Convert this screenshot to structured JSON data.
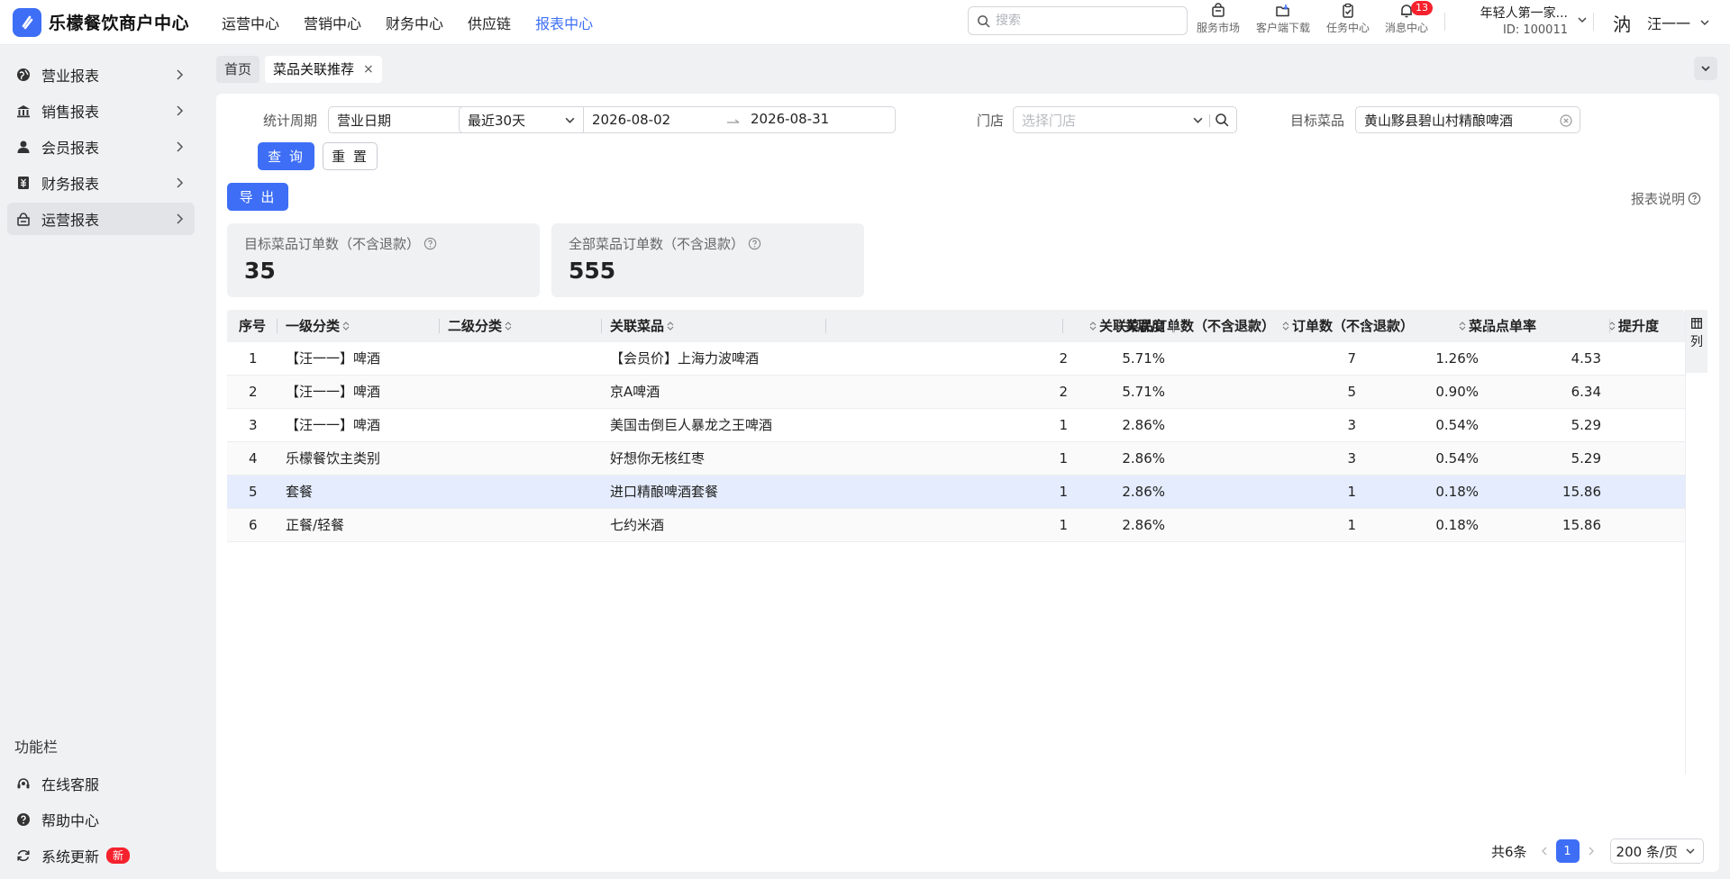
{
  "brand": {
    "name": "乐檬餐饮商户中心",
    "logo_icon": "brand-logo-icon",
    "accent": "#3d6ef5"
  },
  "topnav": [
    {
      "label": "运营中心",
      "active": false
    },
    {
      "label": "营销中心",
      "active": false
    },
    {
      "label": "财务中心",
      "active": false
    },
    {
      "label": "供应链",
      "active": false
    },
    {
      "label": "报表中心",
      "active": true
    }
  ],
  "search": {
    "placeholder": "搜索",
    "value": ""
  },
  "tools": [
    {
      "label": "服务市场",
      "icon": "shop-bag-icon"
    },
    {
      "label": "客户端下载",
      "icon": "folder-download-icon"
    },
    {
      "label": "任务中心",
      "icon": "clipboard-check-icon"
    },
    {
      "label": "消息中心",
      "icon": "bell-icon",
      "badge": "13"
    }
  ],
  "store": {
    "name": "年轻人第一家...",
    "id": "ID: 100011"
  },
  "user": {
    "avatar_text": "汭",
    "name": "汪一一"
  },
  "sidebar": {
    "items": [
      {
        "label": "营业报表",
        "icon": "globe-icon",
        "active": false
      },
      {
        "label": "销售报表",
        "icon": "bank-icon",
        "active": false
      },
      {
        "label": "会员报表",
        "icon": "person-icon",
        "active": false
      },
      {
        "label": "财务报表",
        "icon": "ledger-icon",
        "active": false
      },
      {
        "label": "运营报表",
        "icon": "operations-icon",
        "active": true
      }
    ],
    "func_title": "功能栏",
    "func_items": [
      {
        "label": "在线客服",
        "icon": "headset-icon"
      },
      {
        "label": "帮助中心",
        "icon": "question-circle-icon"
      },
      {
        "label": "系统更新",
        "icon": "refresh-icon",
        "badge": "新"
      }
    ]
  },
  "tabs": [
    {
      "label": "首页",
      "active": false
    },
    {
      "label": "菜品关联推荐",
      "active": true,
      "close": "×"
    }
  ],
  "filters": {
    "period_label": "统计周期",
    "date_type": "营业日期",
    "range_preset": "最近30天",
    "start_date": "2026-08-02",
    "end_date": "2026-08-31",
    "store_label": "门店",
    "store_placeholder": "选择门店",
    "target_label": "目标菜品",
    "target_value": "黄山黟县碧山村精酿啤酒"
  },
  "actions": {
    "query": "查 询",
    "reset": "重 置",
    "export": "导 出",
    "help": "报表说明"
  },
  "stats": [
    {
      "label": "目标菜品订单数（不含退款）",
      "value": "35"
    },
    {
      "label": "全部菜品订单数（不含退款）",
      "value": "555"
    }
  ],
  "table": {
    "columns": [
      "序号",
      "一级分类",
      "二级分类",
      "关联菜品",
      "关联菜品订单数（不含退款）",
      "关联度",
      "订单数（不含退款）",
      "菜品点单率",
      "提升度"
    ],
    "rows": [
      [
        "1",
        "【汪一一】啤酒",
        "",
        "【会员价】上海力波啤酒",
        "2",
        "5.71%",
        "7",
        "1.26%",
        "4.53"
      ],
      [
        "2",
        "【汪一一】啤酒",
        "",
        "京A啤酒",
        "2",
        "5.71%",
        "5",
        "0.90%",
        "6.34"
      ],
      [
        "3",
        "【汪一一】啤酒",
        "",
        "美国击倒巨人暴龙之王啤酒",
        "1",
        "2.86%",
        "3",
        "0.54%",
        "5.29"
      ],
      [
        "4",
        "乐檬餐饮主类别",
        "",
        "好想你无核红枣",
        "1",
        "2.86%",
        "3",
        "0.54%",
        "5.29"
      ],
      [
        "5",
        "套餐",
        "",
        "进口精酿啤酒套餐",
        "1",
        "2.86%",
        "1",
        "0.18%",
        "15.86"
      ],
      [
        "6",
        "正餐/轻餐",
        "",
        "七约米酒",
        "1",
        "2.86%",
        "1",
        "0.18%",
        "15.86"
      ]
    ],
    "highlight_row": 5,
    "column_setting": "列"
  },
  "pagination": {
    "total": "共6条",
    "current": "1",
    "page_size": "200 条/页"
  }
}
